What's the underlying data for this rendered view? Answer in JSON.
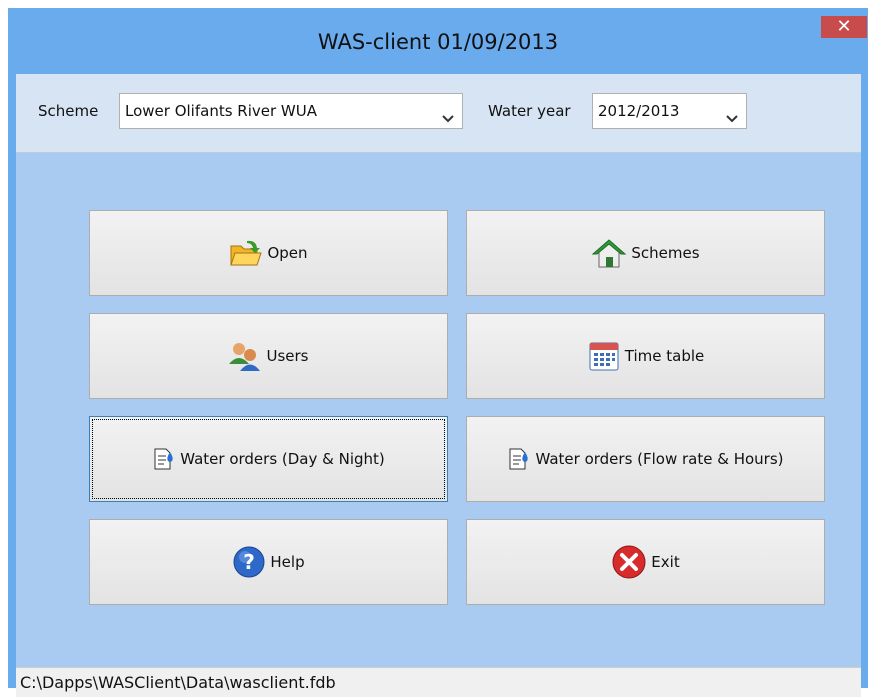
{
  "window": {
    "title": "WAS-client 01/09/2013",
    "close_glyph": "✕"
  },
  "filters": {
    "scheme_label": "Scheme",
    "scheme_value": "Lower Olifants River WUA",
    "year_label": "Water year",
    "year_value": "2012/2013"
  },
  "buttons": [
    {
      "label": "Open",
      "icon": "open-folder-icon"
    },
    {
      "label": "Schemes",
      "icon": "house-icon"
    },
    {
      "label": "Users",
      "icon": "users-icon"
    },
    {
      "label": "Time table",
      "icon": "calendar-icon"
    },
    {
      "label": "Water orders (Day & Night)",
      "icon": "water-order-icon"
    },
    {
      "label": "Water orders (Flow rate & Hours)",
      "icon": "water-order-icon"
    },
    {
      "label": "Help",
      "icon": "help-icon"
    },
    {
      "label": "Exit",
      "icon": "exit-icon"
    }
  ],
  "status": {
    "path": "C:\\Dapps\\WASClient\\Data\\wasclient.fdb"
  },
  "colors": {
    "frame": "#6aabee",
    "client": "#a9cbf1",
    "close": "#c84c4c"
  }
}
